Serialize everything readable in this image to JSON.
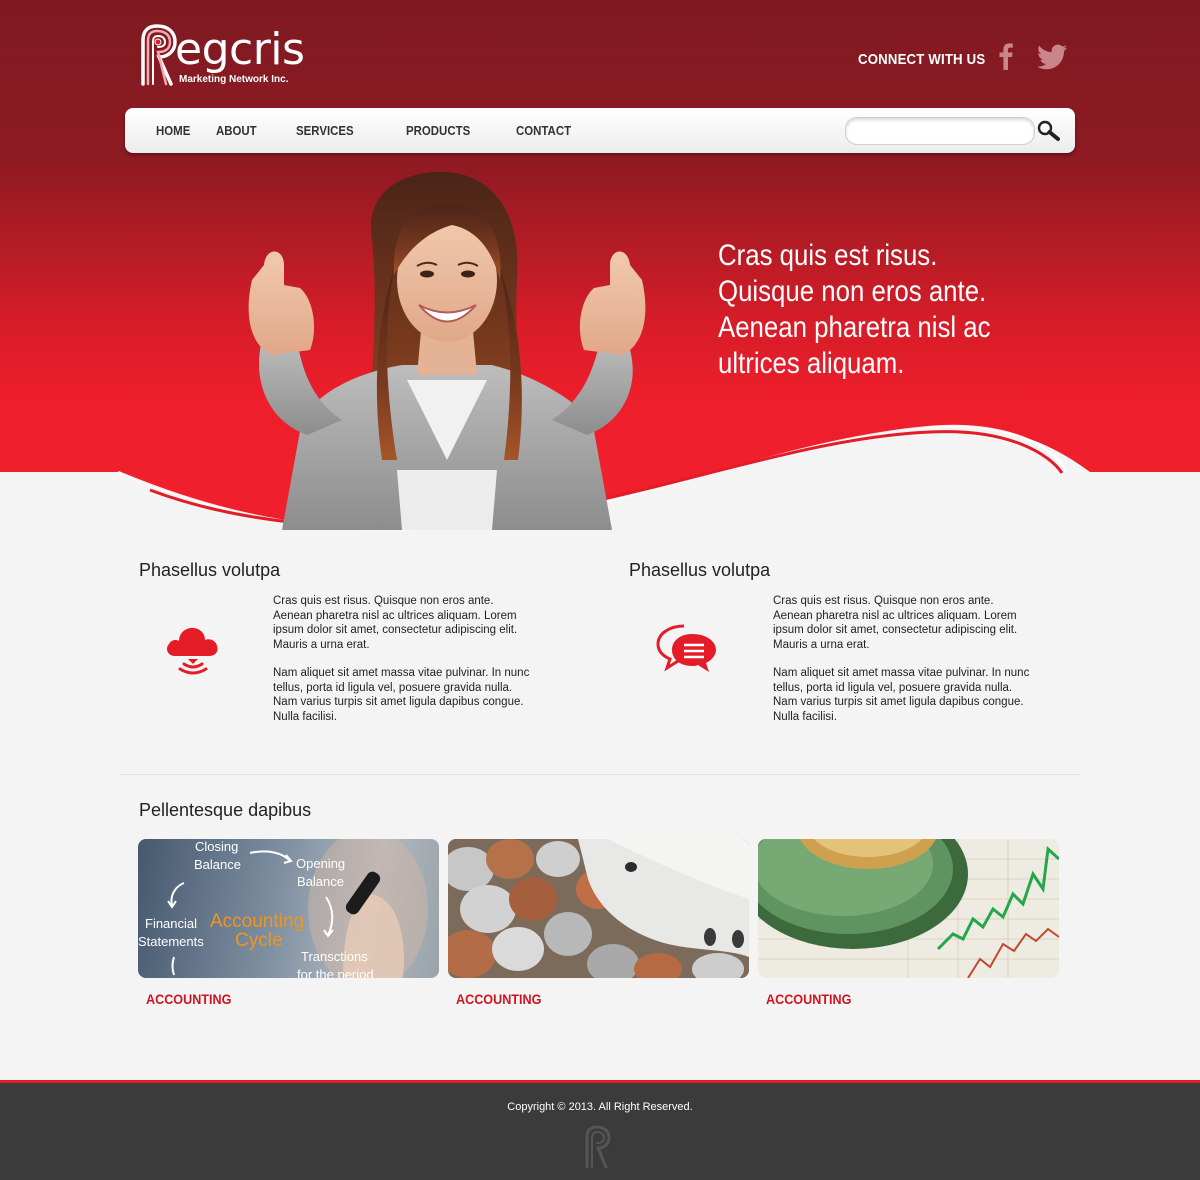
{
  "brand": {
    "name": "egcris",
    "tagline": "Marketing Network Inc.",
    "accent": "#e31c28",
    "dark_red": "#7f1a21"
  },
  "header": {
    "connect_label": "CONNECT WITH US",
    "social": [
      "facebook-icon",
      "twitter-icon"
    ]
  },
  "nav": {
    "items": [
      "HOME",
      "ABOUT",
      "SERVICES",
      "PRODUCTS",
      "CONTACT"
    ],
    "search_value": ""
  },
  "hero": {
    "text": "Cras quis est risus. Quisque non eros ante. Aenean pharetra nisl ac ultrices aliquam."
  },
  "features": [
    {
      "title": "Phasellus volutpa",
      "icon": "cloud-icon",
      "p1": "Cras quis est risus. Quisque non eros ante. Aenean pharetra nisl ac ultrices aliquam. Lorem ipsum dolor sit amet, consectetur adipiscing elit. Mauris a urna erat.",
      "p2": "Nam aliquet sit amet massa vitae pulvinar. In nunc tellus, porta id ligula vel, posuere gravida nulla. Nam varius turpis sit amet ligula dapibus congue. Nulla facilisi."
    },
    {
      "title": "Phasellus volutpa",
      "icon": "chat-bubbles-icon",
      "p1": "Cras quis est risus. Quisque non eros ante. Aenean pharetra nisl ac ultrices aliquam. Lorem ipsum dolor sit amet, consectetur adipiscing elit. Mauris a urna erat.",
      "p2": "Nam aliquet sit amet massa vitae pulvinar. In nunc tellus, porta id ligula vel, posuere gravida nulla. Nam varius turpis sit amet ligula dapibus congue. Nulla facilisi."
    }
  ],
  "gallery": {
    "title": "Pellentesque dapibus",
    "cards": [
      {
        "label": "ACCOUNTING",
        "image": "accounting-cycle-image",
        "diagram": {
          "closing": "Closing",
          "closing2": "Balance",
          "opening": "Opening",
          "opening2": "Balance",
          "financial": "Financial",
          "financial2": "Statements",
          "cycle1": "Accounting",
          "cycle2": "Cycle",
          "trans1": "Transctions",
          "trans2": "for the period"
        }
      },
      {
        "label": "ACCOUNTING",
        "image": "piggy-bank-coins-image"
      },
      {
        "label": "ACCOUNTING",
        "image": "coins-stock-chart-image"
      }
    ]
  },
  "footer": {
    "copyright": "Copyright © 2013. All Right Reserved."
  }
}
